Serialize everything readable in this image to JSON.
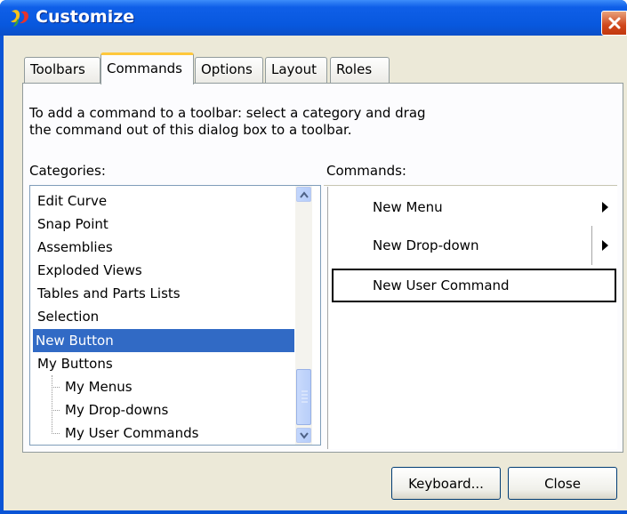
{
  "window": {
    "title": "Customize"
  },
  "tabs": [
    {
      "label": "Toolbars",
      "active": false
    },
    {
      "label": "Commands",
      "active": true
    },
    {
      "label": "Options",
      "active": false
    },
    {
      "label": "Layout",
      "active": false
    },
    {
      "label": "Roles",
      "active": false
    }
  ],
  "instructions": {
    "line1": "To add a command to a toolbar: select a category and drag",
    "line2": "the command out of this dialog box to a toolbar."
  },
  "categories": {
    "label": "Categories:",
    "items": [
      {
        "label": "Edit Curve"
      },
      {
        "label": "Snap Point"
      },
      {
        "label": "Assemblies"
      },
      {
        "label": "Exploded Views"
      },
      {
        "label": "Tables and Parts Lists"
      },
      {
        "label": "Selection"
      },
      {
        "label": "New Button",
        "selected": true
      },
      {
        "label": "My Buttons"
      },
      {
        "label": "My Menus"
      },
      {
        "label": "My Drop-downs"
      },
      {
        "label": "My User Commands"
      }
    ]
  },
  "commands": {
    "label": "Commands:",
    "items": [
      {
        "label": "New Menu",
        "has_submenu": true
      },
      {
        "label": "New Drop-down",
        "has_submenu": true
      },
      {
        "label": "New User Command",
        "has_submenu": false
      }
    ]
  },
  "buttons": {
    "keyboard": "Keyboard...",
    "close": "Close"
  },
  "colors": {
    "title_bar": "#0858de",
    "selection": "#316ac5",
    "active_tab_accent": "#ffc83c",
    "close_button": "#d0461b",
    "dialog_face": "#ece9d8"
  },
  "icons": {
    "app": "app-logo-icon",
    "close": "close-icon",
    "scroll_up": "scroll-up-arrow-icon",
    "scroll_down": "scroll-down-arrow-icon",
    "submenu": "submenu-arrow-icon"
  }
}
